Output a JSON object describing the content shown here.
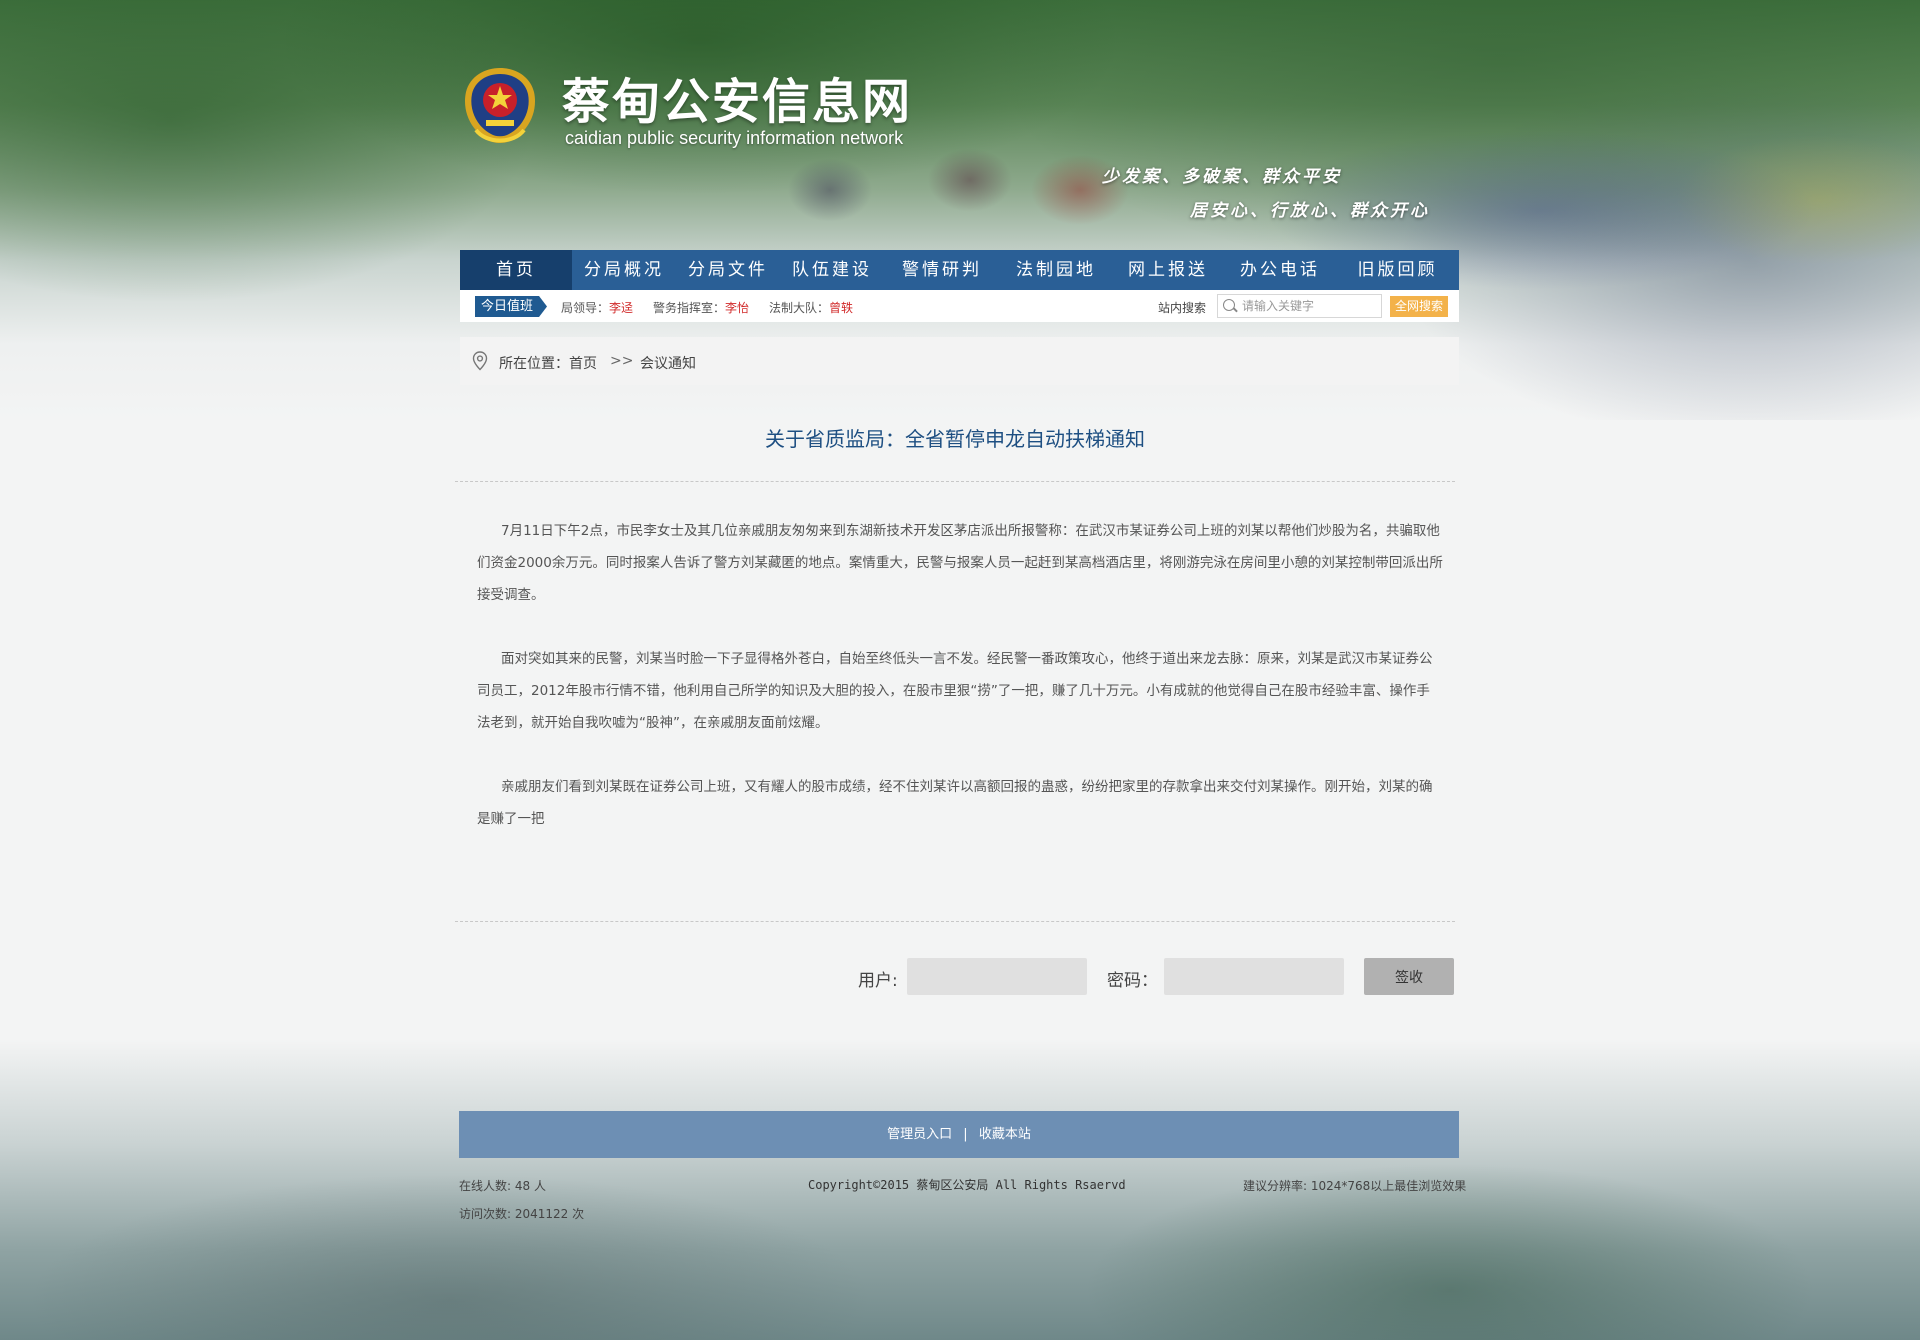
{
  "header": {
    "site_title": "蔡甸公安信息网",
    "site_subtitle": "caidian  public security information network",
    "slogan_line1": "少发案、多破案、群众平安",
    "slogan_line2": "居安心、行放心、群众开心"
  },
  "nav": {
    "items": [
      {
        "label": "首页",
        "active": true
      },
      {
        "label": "分局概况"
      },
      {
        "label": "分局文件"
      },
      {
        "label": "队伍建设"
      },
      {
        "label": "警情研判"
      },
      {
        "label": "法制园地"
      },
      {
        "label": "网上报送"
      },
      {
        "label": "办公电话"
      },
      {
        "label": "旧版回顾"
      }
    ]
  },
  "duty": {
    "label": "今日值班",
    "entries": [
      {
        "role": "局领导：",
        "name": "李迳"
      },
      {
        "role": "警务指挥室：",
        "name": "李怡"
      },
      {
        "role": "法制大队：",
        "name": "曾轶"
      }
    ],
    "search_label": "站内搜索",
    "search_placeholder": "请输入关键字",
    "search_button": "全网搜索"
  },
  "breadcrumb": {
    "label": "所在位置：",
    "home": "首页",
    "separator": ">>",
    "current": "会议通知"
  },
  "article": {
    "title": "关于省质监局：全省暂停申龙自动扶梯通知",
    "paragraphs": [
      "7月11日下午2点，市民李女士及其几位亲戚朋友匆匆来到东湖新技术开发区茅店派出所报警称：在武汉市某证券公司上班的刘某以帮他们炒股为名，共骗取他们资金2000余万元。同时报案人告诉了警方刘某藏匿的地点。案情重大，民警与报案人员一起赶到某高档酒店里，将刚游完泳在房间里小憩的刘某控制带回派出所接受调查。",
      "面对突如其来的民警，刘某当时脸一下子显得格外苍白，自始至终低头一言不发。经民警一番政策攻心，他终于道出来龙去脉：原来，刘某是武汉市某证券公司员工，2012年股市行情不错，他利用自己所学的知识及大胆的投入，在股市里狠“捞”了一把，赚了几十万元。小有成就的他觉得自己在股市经验丰富、操作手法老到，就开始自我吹嘘为“股神”，在亲戚朋友面前炫耀。",
      "亲戚朋友们看到刘某既在证券公司上班，又有耀人的股市成绩，经不住刘某许以高额回报的蛊惑，纷纷把家里的存款拿出来交付刘某操作。刚开始，刘某的确是赚了一把"
    ]
  },
  "signin": {
    "user_label": "用户:",
    "user_value": "",
    "password_label": "密码：",
    "password_value": "",
    "button": "签收"
  },
  "footer": {
    "admin_link": "管理员入口",
    "divider": "|",
    "bookmark_link": "收藏本站",
    "online_label": "在线人数: 48 人",
    "visits_label": "访问次数: 2041122 次",
    "copyright": "Copyright©2015  蔡甸区公安局  All Rights Rsaervd",
    "resolution": "建议分辨率: 1024*768以上最佳浏览效果"
  },
  "colors": {
    "nav_bg": "#2a5f96",
    "nav_active": "#163f6c",
    "title": "#1e4f82",
    "duty_name": "#d12a2a",
    "search_button": "#f3b24a",
    "footer_bar": "#6d8fb4"
  },
  "icons": {
    "emblem": "police-emblem-icon",
    "location": "map-pin-icon",
    "search": "search-icon"
  }
}
